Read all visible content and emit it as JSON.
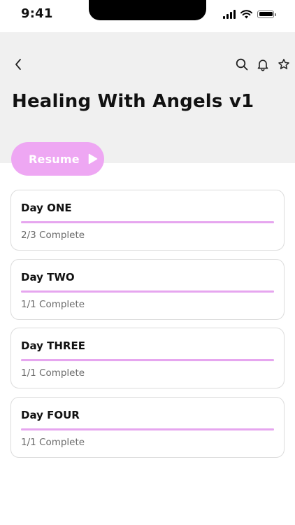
{
  "status_bar": {
    "time": "9:41"
  },
  "header": {
    "title": "Healing With Angels v1",
    "icons": [
      "chevron-left-icon",
      "search-icon",
      "bell-icon",
      "star-icon"
    ]
  },
  "resume_button": {
    "label": "Resume"
  },
  "colors": {
    "accent": "#eea7f3",
    "progress": "#e6a6ef",
    "header_bg": "#f0f0f0"
  },
  "days": [
    {
      "title": "Day ONE",
      "status": "2/3 Complete",
      "progress": 1.0
    },
    {
      "title": "Day TWO",
      "status": "1/1 Complete",
      "progress": 1.0
    },
    {
      "title": "Day THREE",
      "status": "1/1 Complete",
      "progress": 1.0
    },
    {
      "title": "Day FOUR",
      "status": "1/1 Complete",
      "progress": 1.0
    }
  ]
}
